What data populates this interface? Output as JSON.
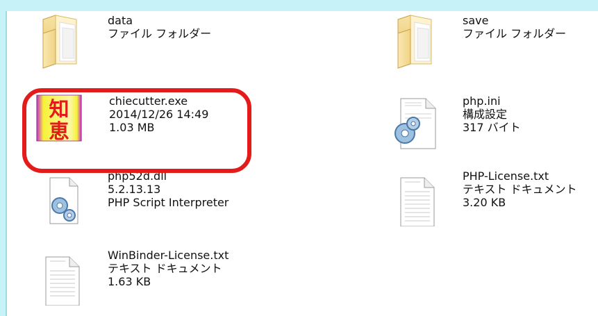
{
  "files": [
    {
      "name": "data",
      "line2": "ファイル フォルダー",
      "icon": "folder-icon"
    },
    {
      "name": "save",
      "line2": "ファイル フォルダー",
      "icon": "folder-icon"
    },
    {
      "name": "chiecutter.exe",
      "line2": "2014/12/26 14:49",
      "line3": "1.03 MB",
      "icon": "chiecutter-app-icon",
      "icon_glyphs": [
        "知",
        "恵"
      ],
      "highlighted": true,
      "highlight_color": "#e41b1b"
    },
    {
      "name": "php.ini",
      "line2": "構成設定",
      "line3": "317 バイト",
      "icon": "settings-file-icon"
    },
    {
      "name": "php52d.dll",
      "line2": "5.2.13.13",
      "line3": "PHP Script Interpreter",
      "icon": "dll-gear-icon"
    },
    {
      "name": "PHP-License.txt",
      "line2": "テキスト ドキュメント",
      "line3": "3.20 KB",
      "icon": "text-document-icon"
    },
    {
      "name": "WinBinder-License.txt",
      "line2": "テキスト ドキュメント",
      "line3": "1.63 KB",
      "icon": "text-document-icon"
    }
  ]
}
